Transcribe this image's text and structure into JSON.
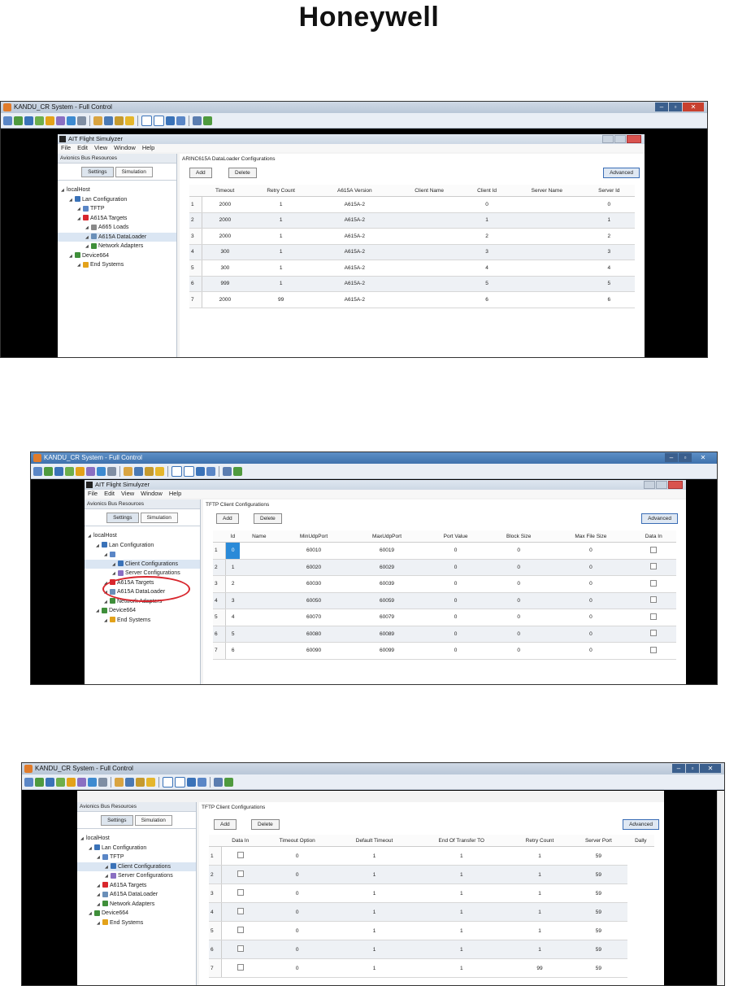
{
  "logo": "Honeywell",
  "shot1": {
    "window_title": "KANDU_CR System - Full Control",
    "app_title": "AIT Flight Simulyzer",
    "menu": [
      "File",
      "Edit",
      "View",
      "Window",
      "Help"
    ],
    "panel_header": "Avionics Bus Resources",
    "tabs": [
      "Settings",
      "Simulation"
    ],
    "tree": [
      {
        "label": "localHost",
        "indent": 0,
        "icon": "server-icon"
      },
      {
        "label": "Lan Configuration",
        "indent": 1,
        "icon": "lan-icon"
      },
      {
        "label": "TFTP",
        "indent": 2,
        "icon": "tftp-icon"
      },
      {
        "label": "A615A Targets",
        "indent": 2,
        "icon": "target-icon"
      },
      {
        "label": "A665 Loads",
        "indent": 3,
        "icon": "loads-icon"
      },
      {
        "label": "A615A DataLoader",
        "indent": 3,
        "icon": "dataloader-icon",
        "selected": true
      },
      {
        "label": "Network Adapters",
        "indent": 3,
        "icon": "network-adapter-icon"
      },
      {
        "label": "Device664",
        "indent": 1,
        "icon": "device-icon"
      },
      {
        "label": "End Systems",
        "indent": 2,
        "icon": "end-systems-icon"
      }
    ],
    "content_title": "ARINC615A DataLoader Configurations",
    "buttons": {
      "add": "Add",
      "delete": "Delete",
      "advanced": "Advanced"
    },
    "columns": [
      "Timeout",
      "Retry Count",
      "A615A Version",
      "Client Name",
      "Client Id",
      "Server Name",
      "Server Id"
    ],
    "rows": [
      [
        "1",
        "2000",
        "1",
        "A615A-2",
        "",
        "0",
        "",
        "0"
      ],
      [
        "2",
        "2000",
        "1",
        "A615A-2",
        "",
        "1",
        "",
        "1"
      ],
      [
        "3",
        "2000",
        "1",
        "A615A-2",
        "",
        "2",
        "",
        "2"
      ],
      [
        "4",
        "300",
        "1",
        "A615A-2",
        "",
        "3",
        "",
        "3"
      ],
      [
        "5",
        "300",
        "1",
        "A615A-2",
        "",
        "4",
        "",
        "4"
      ],
      [
        "6",
        "999",
        "1",
        "A615A-2",
        "",
        "5",
        "",
        "5"
      ],
      [
        "7",
        "2000",
        "99",
        "A615A-2",
        "",
        "6",
        "",
        "6"
      ]
    ]
  },
  "shot2": {
    "window_title": "KANDU_CR System - Full Control",
    "app_title": "AIT Flight Simulyzer",
    "menu": [
      "File",
      "Edit",
      "View",
      "Window",
      "Help"
    ],
    "panel_header": "Avionics Bus Resources",
    "tabs": [
      "Settings",
      "Simulation"
    ],
    "tree": [
      {
        "label": "localHost",
        "indent": 0,
        "icon": "server-icon"
      },
      {
        "label": "Lan Configuration",
        "indent": 1,
        "icon": "lan-icon"
      },
      {
        "label": "",
        "indent": 2,
        "icon": "tftp-icon"
      },
      {
        "label": "Client Configurations",
        "indent": 3,
        "icon": "client-config-icon",
        "selected": true
      },
      {
        "label": "Server Configurations",
        "indent": 3,
        "icon": "server-config-icon"
      },
      {
        "label": "A615A Targets",
        "indent": 2,
        "icon": "target-icon"
      },
      {
        "label": "A615A DataLoader",
        "indent": 2,
        "icon": "dataloader-icon"
      },
      {
        "label": "Network Adapters",
        "indent": 2,
        "icon": "network-adapter-icon"
      },
      {
        "label": "Device664",
        "indent": 1,
        "icon": "device-icon"
      },
      {
        "label": "End Systems",
        "indent": 2,
        "icon": "end-systems-icon"
      }
    ],
    "content_title": "TFTP Client Configurations",
    "buttons": {
      "add": "Add",
      "delete": "Delete",
      "advanced": "Advanced"
    },
    "columns": [
      "Id",
      "Name",
      "MinUdpPort",
      "MaxUdpPort",
      "Port Value",
      "Block Size",
      "Max File Size",
      "Data In"
    ],
    "rows": [
      [
        "1",
        "0",
        "",
        "60010",
        "60019",
        "0",
        "0",
        "0"
      ],
      [
        "2",
        "1",
        "",
        "60020",
        "60029",
        "0",
        "0",
        "0"
      ],
      [
        "3",
        "2",
        "",
        "60030",
        "60039",
        "0",
        "0",
        "0"
      ],
      [
        "4",
        "3",
        "",
        "60050",
        "60059",
        "0",
        "0",
        "0"
      ],
      [
        "5",
        "4",
        "",
        "60070",
        "60079",
        "0",
        "0",
        "0"
      ],
      [
        "6",
        "5",
        "",
        "60080",
        "60089",
        "0",
        "0",
        "0"
      ],
      [
        "7",
        "6",
        "",
        "60090",
        "60099",
        "0",
        "0",
        "0"
      ]
    ]
  },
  "shot3": {
    "window_title": "KANDU_CR System - Full Control",
    "panel_header": "Avionics Bus Resources",
    "tabs": [
      "Settings",
      "Simulation"
    ],
    "tree": [
      {
        "label": "localHost",
        "indent": 0,
        "icon": "server-icon"
      },
      {
        "label": "Lan Configuration",
        "indent": 1,
        "icon": "lan-icon"
      },
      {
        "label": "TFTP",
        "indent": 2,
        "icon": "tftp-icon"
      },
      {
        "label": "Client Configurations",
        "indent": 3,
        "icon": "client-config-icon",
        "selected": true
      },
      {
        "label": "Server Configurations",
        "indent": 3,
        "icon": "server-config-icon"
      },
      {
        "label": "A615A Targets",
        "indent": 2,
        "icon": "target-icon"
      },
      {
        "label": "A615A DataLoader",
        "indent": 2,
        "icon": "dataloader-icon"
      },
      {
        "label": "Network Adapters",
        "indent": 2,
        "icon": "network-adapter-icon"
      },
      {
        "label": "Device664",
        "indent": 1,
        "icon": "device-icon"
      },
      {
        "label": "End Systems",
        "indent": 2,
        "icon": "end-systems-icon"
      }
    ],
    "content_title": "TFTP Client Configurations",
    "buttons": {
      "add": "Add",
      "delete": "Delete",
      "advanced": "Advanced"
    },
    "columns": [
      "Data In",
      "Timeout Option",
      "Default Timeout",
      "End Of Transfer TO",
      "Retry Count",
      "Server Port",
      "Dally"
    ],
    "rows": [
      [
        "1",
        "",
        "0",
        "1",
        "1",
        "1",
        "59"
      ],
      [
        "2",
        "",
        "0",
        "1",
        "1",
        "1",
        "59"
      ],
      [
        "3",
        "",
        "0",
        "1",
        "1",
        "1",
        "59"
      ],
      [
        "4",
        "",
        "0",
        "1",
        "1",
        "1",
        "59"
      ],
      [
        "5",
        "",
        "0",
        "1",
        "1",
        "1",
        "59"
      ],
      [
        "6",
        "",
        "0",
        "1",
        "1",
        "1",
        "59"
      ],
      [
        "7",
        "",
        "0",
        "1",
        "1",
        "99",
        "59"
      ]
    ]
  },
  "colors": {
    "accent": "#2a8ad8",
    "close": "#c8402e",
    "highlight_circle": "#d8262d"
  }
}
